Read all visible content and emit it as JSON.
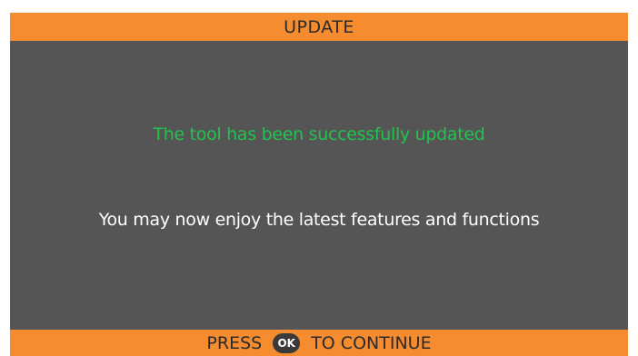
{
  "header": {
    "title": "UPDATE"
  },
  "message": {
    "success": "The tool has been successfully updated",
    "info": "You may now enjoy the latest features and functions"
  },
  "footer": {
    "press_label": "PRESS",
    "ok_label": "OK",
    "continue_label": "TO CONTINUE"
  },
  "colors": {
    "accent": "#f58c2f",
    "panel": "#555555",
    "success_text": "#22c24f",
    "body_text": "#ffffff"
  }
}
